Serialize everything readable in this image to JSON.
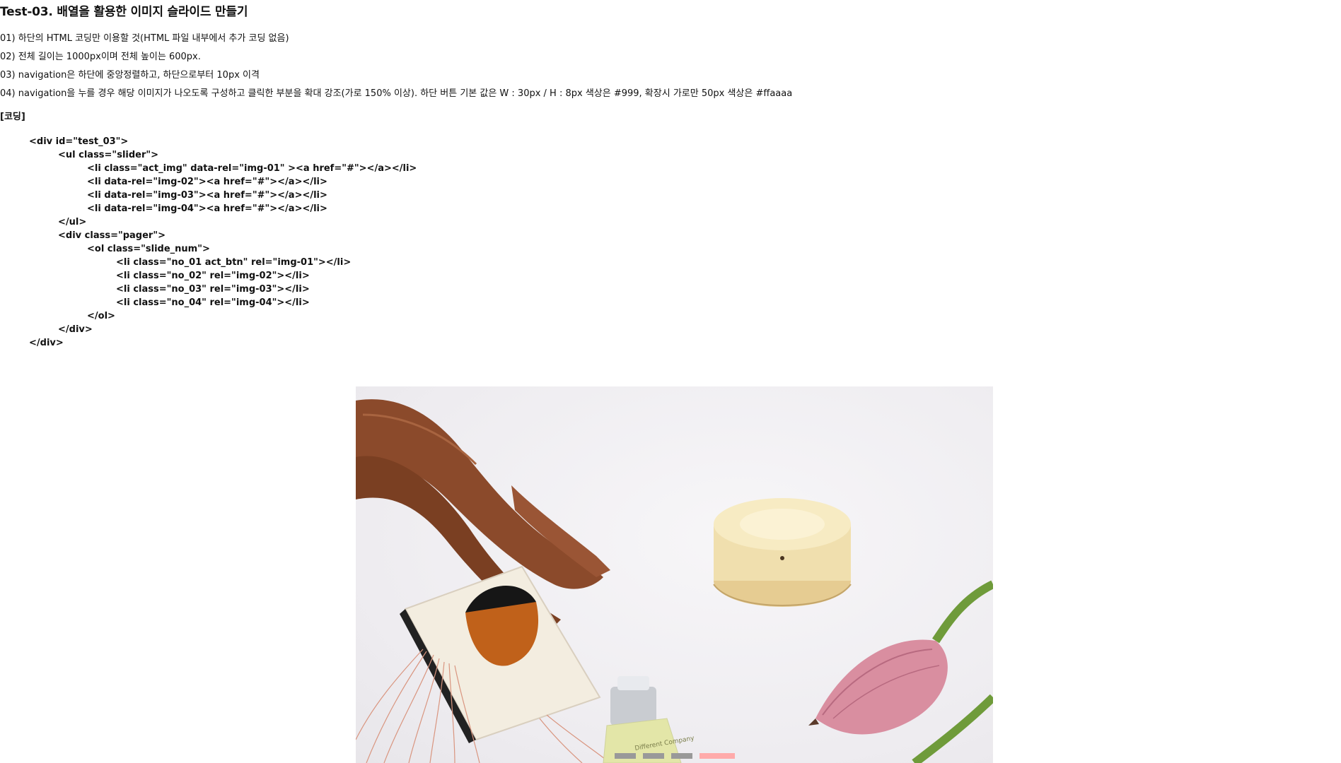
{
  "title": "Test-03. 배열을 활용한 이미지 슬라이드 만들기",
  "requirements": [
    "01) 하단의 HTML 코딩만 이용할 것(HTML 파일 내부에서 추가 코딩 없음)",
    "02) 전체 길이는 1000px이며 전체 높이는 600px.",
    "03) navigation은 하단에 중앙정렬하고, 하단으로부터 10px 이격",
    "04) navigation을 누를 경우 해당 이미지가 나오도록 구성하고 클릭한 부분을 확대 강조(가로 150% 이상). 하단 버튼 기본 값은 W : 30px / H : 8px 색상은 #999, 확장시 가로만 50px 색상은 #ffaaaa"
  ],
  "coding_label": "[코딩]",
  "code_lines": [
    "<div id=\"test_03\">",
    "<ul class=\"slider\">",
    "<li class=\"act_img\" data-rel=\"img-01\" ><a href=\"#\"></a></li>",
    "<li data-rel=\"img-02\"><a href=\"#\"></a></li>",
    "<li data-rel=\"img-03\"><a href=\"#\"></a></li>",
    "<li data-rel=\"img-04\"><a href=\"#\"></a></li>",
    "</ul>",
    "<div class=\"pager\">",
    "<ol class=\"slide_num\">",
    "<li class=\"no_01 act_btn\" rel=\"img-01\"></li>",
    "<li class=\"no_02\" rel=\"img-02\"></li>",
    "<li class=\"no_03\" rel=\"img-03\"></li>",
    "<li class=\"no_04\" rel=\"img-04\"></li>",
    "</ol>",
    "</div>",
    "</div>"
  ],
  "slider": {
    "image_text": "Different Company",
    "pager": {
      "count": 4,
      "active_index": 3,
      "default_color": "#999999",
      "active_color": "#ffaaaa"
    }
  }
}
